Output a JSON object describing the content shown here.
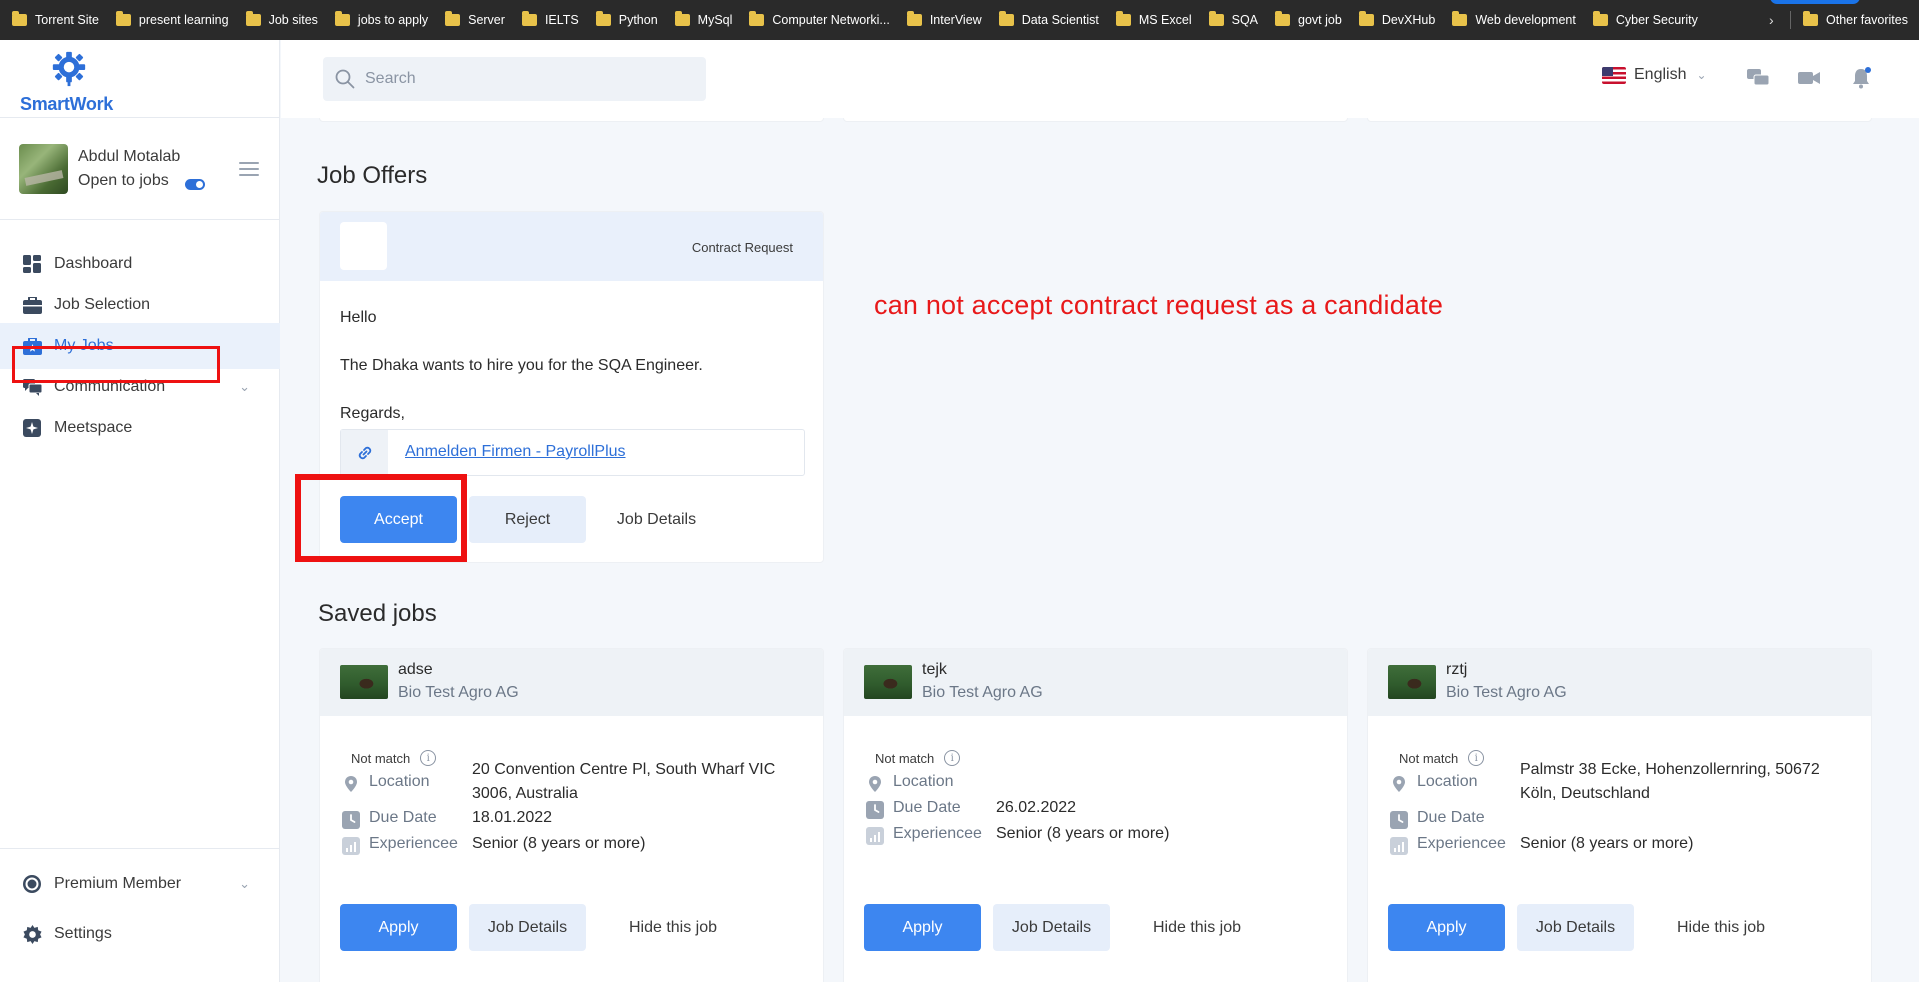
{
  "bookmarks": {
    "items": [
      "Torrent Site",
      "present learning",
      "Job sites",
      "jobs to apply",
      "Server",
      "IELTS",
      "Python",
      "MySql",
      "Computer Networki...",
      "InterView",
      "Data Scientist",
      "MS Excel",
      "SQA",
      "govt job",
      "DevXHub",
      "Web development",
      "Cyber Security"
    ],
    "other": "Other favorites"
  },
  "brand": {
    "name": "SmartWork",
    "color": "#2d6fd8"
  },
  "profile": {
    "name": "Abdul Motalab",
    "status": "Open to jobs"
  },
  "nav": {
    "dashboard": "Dashboard",
    "job_selection": "Job Selection",
    "my_jobs": "My Jobs",
    "communication": "Communication",
    "meetspace": "Meetspace",
    "premium": "Premium Member",
    "settings": "Settings"
  },
  "search": {
    "placeholder": "Search"
  },
  "language": {
    "selected": "English"
  },
  "offers": {
    "title": "Job Offers",
    "card": {
      "type": "Contract Request",
      "greeting": "Hello",
      "message": "The Dhaka wants to hire you for the SQA Engineer.",
      "signoff": "Regards,",
      "link_text": "Anmelden Firmen - PayrollPlus",
      "accept": "Accept",
      "reject": "Reject",
      "details": "Job Details"
    }
  },
  "annotation": "can not accept contract request as a candidate",
  "saved": {
    "title": "Saved jobs",
    "labels": {
      "match": "Not match",
      "location": "Location",
      "due": "Due Date",
      "experience": "Experiencee",
      "apply": "Apply",
      "details": "Job Details",
      "hide": "Hide this job"
    },
    "jobs": [
      {
        "title": "adse",
        "company": "Bio Test Agro AG",
        "location_line1": "20 Convention Centre Pl, South Wharf VIC",
        "location_line2": "3006, Australia",
        "due": "18.01.2022",
        "experience": "Senior (8 years or more)"
      },
      {
        "title": "tejk",
        "company": "Bio Test Agro AG",
        "location_line1": "",
        "location_line2": "",
        "due": "26.02.2022",
        "experience": "Senior (8 years or more)"
      },
      {
        "title": "rztj",
        "company": "Bio Test Agro AG",
        "location_line1": "Palmstr 38 Ecke, Hohenzollernring, 50672",
        "location_line2": "Köln, Deutschland",
        "due": "",
        "experience": "Senior (8 years or more)"
      }
    ]
  },
  "colors": {
    "primary": "#3d86f0",
    "annotation": "#e8191a",
    "highlight_box": "#ee1111"
  }
}
